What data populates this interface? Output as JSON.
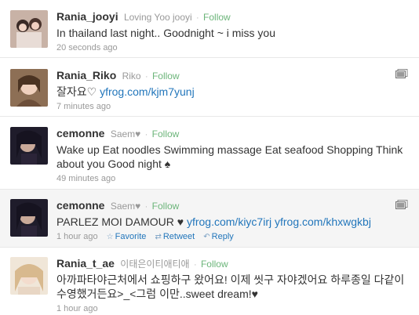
{
  "tweets": [
    {
      "screen_name": "Rania_jooyi",
      "full_name": "Loving Yoo jooyi",
      "follow_label": "Follow",
      "text": "In thailand last night.. Goodnight ~ i miss you",
      "link": "",
      "time": "20 seconds ago"
    },
    {
      "screen_name": "Rania_Riko",
      "full_name": "Riko",
      "follow_label": "Follow",
      "text": "잘자요♡ ",
      "link": "yfrog.com/kjm7yunj",
      "time": "7 minutes ago"
    },
    {
      "screen_name": "cemonne",
      "full_name": "Saem♥",
      "follow_label": "Follow",
      "text": "Wake up Eat noodles Swimming massage Eat seafood Shopping Think about you Good night ♠",
      "link": "",
      "time": "49 minutes ago"
    },
    {
      "screen_name": "cemonne",
      "full_name": "Saem♥",
      "follow_label": "Follow",
      "text": "PARLEZ MOI DAMOUR ♥ ",
      "link": "yfrog.com/kiyc7irj",
      "link2": "yfrog.com/khxwgkbj",
      "time": "1 hour ago",
      "favorite_label": "Favorite",
      "retweet_label": "Retweet",
      "reply_label": "Reply"
    },
    {
      "screen_name": "Rania_t_ae",
      "full_name": "이태은이티애티애",
      "follow_label": "Follow",
      "text": "아까파타야근처에서 쇼핑하구 왔어요! 이제 씻구 자야겠어요 하루종일 다같이 수영했거든요>_<그럼 이만..sweet dream!♥",
      "link": "",
      "time": "1 hour ago"
    }
  ],
  "icons": {
    "media": "media-icon",
    "favorite": "star-icon",
    "retweet": "retweet-icon",
    "reply": "reply-icon"
  },
  "colors": {
    "link": "#2276bb",
    "follow": "#6cb57a",
    "hover_bg": "#f5f5f5"
  }
}
